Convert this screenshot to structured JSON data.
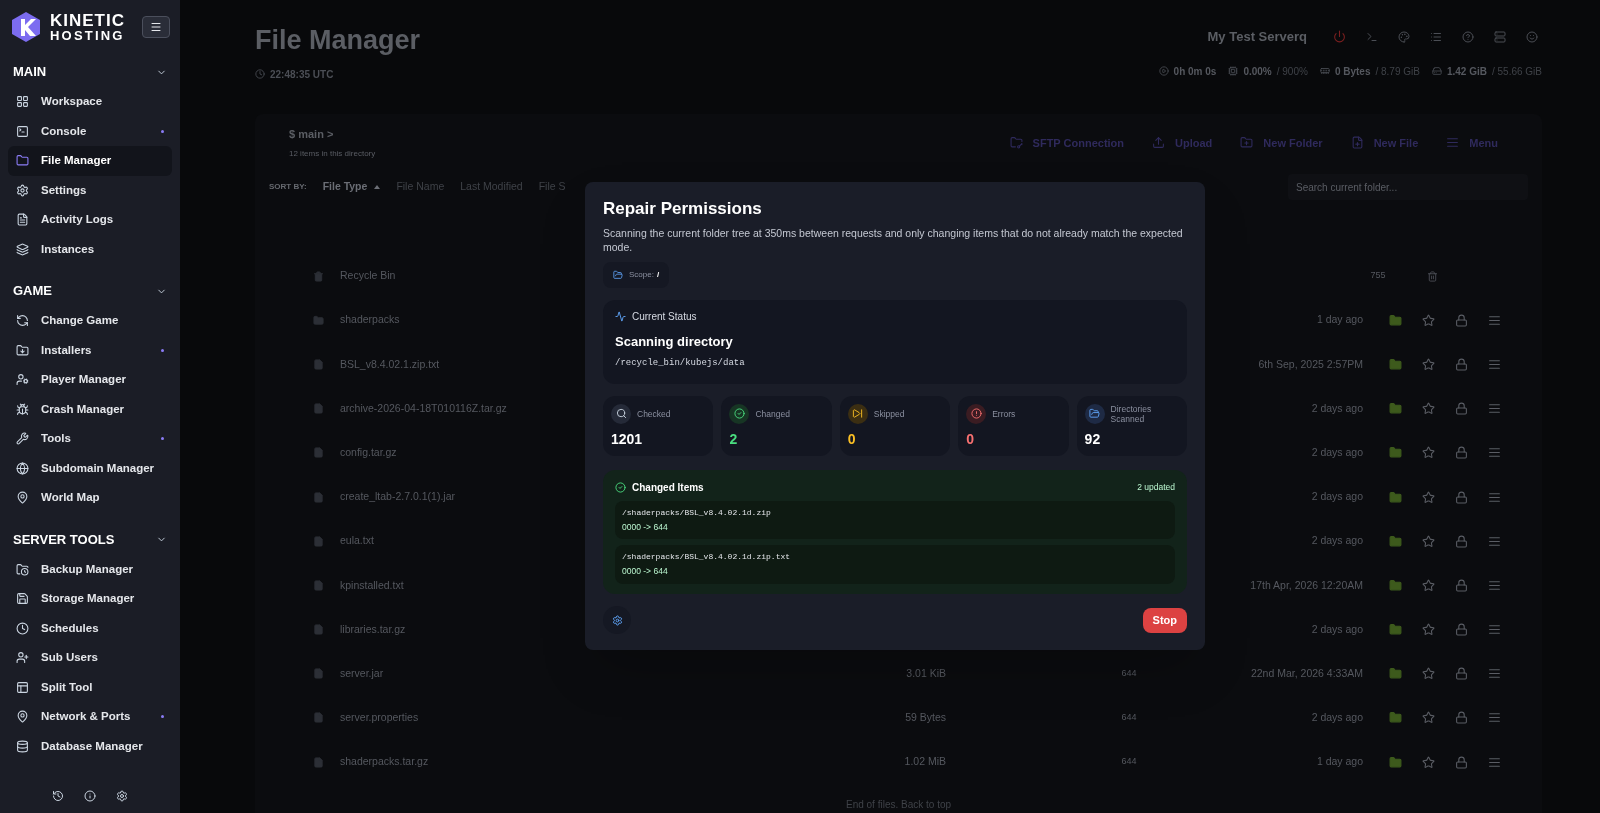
{
  "brand": {
    "line_1": "KINETIC",
    "line_2": "HOSTING"
  },
  "sidebar": {
    "sections": [
      {
        "title": "MAIN",
        "expanded": true,
        "items": [
          {
            "label": "Workspace",
            "selected": false,
            "dot": false
          },
          {
            "label": "Console",
            "selected": false,
            "dot": true
          },
          {
            "label": "File Manager",
            "selected": true,
            "dot": false
          },
          {
            "label": "Settings",
            "selected": false,
            "dot": false
          },
          {
            "label": "Activity Logs",
            "selected": false,
            "dot": false
          },
          {
            "label": "Instances",
            "selected": false,
            "dot": false
          }
        ]
      },
      {
        "title": "GAME",
        "expanded": true,
        "items": [
          {
            "label": "Change Game",
            "selected": false,
            "dot": false
          },
          {
            "label": "Installers",
            "selected": false,
            "dot": true
          },
          {
            "label": "Player Manager",
            "selected": false,
            "dot": false
          },
          {
            "label": "Crash Manager",
            "selected": false,
            "dot": false
          },
          {
            "label": "Tools",
            "selected": false,
            "dot": true
          },
          {
            "label": "Subdomain Manager",
            "selected": false,
            "dot": false
          },
          {
            "label": "World Map",
            "selected": false,
            "dot": false
          }
        ]
      },
      {
        "title": "SERVER TOOLS",
        "expanded": true,
        "items": [
          {
            "label": "Backup Manager",
            "selected": false,
            "dot": false
          },
          {
            "label": "Storage Manager",
            "selected": false,
            "dot": false
          },
          {
            "label": "Schedules",
            "selected": false,
            "dot": false
          },
          {
            "label": "Sub Users",
            "selected": false,
            "dot": false
          },
          {
            "label": "Split Tool",
            "selected": false,
            "dot": false
          },
          {
            "label": "Network & Ports",
            "selected": false,
            "dot": true
          },
          {
            "label": "Database Manager",
            "selected": false,
            "dot": false
          }
        ]
      }
    ]
  },
  "header": {
    "title": "File Manager",
    "clock": "22:48:35 UTC",
    "server_name": "My Test Serverq",
    "stats": [
      {
        "value": "0h 0m 0s"
      },
      {
        "value": "0.00%",
        "limit": "/ 900%"
      },
      {
        "value": "0 Bytes",
        "limit": "/ 8.79 GiB"
      },
      {
        "value": "1.42 GiB",
        "limit": "/ 55.66 GiB"
      }
    ]
  },
  "toolbar": {
    "path": "$ main >",
    "item_count": "12 items in this directory",
    "buttons": [
      "SFTP Connection",
      "Upload",
      "New Folder",
      "New File",
      "Menu"
    ]
  },
  "sort": {
    "label": "SORT BY:",
    "options": [
      {
        "label": "File Type",
        "selected": true
      },
      {
        "label": "File Name",
        "selected": false
      },
      {
        "label": "Last Modified",
        "selected": false
      },
      {
        "label": "File S",
        "selected": false
      }
    ]
  },
  "search": {
    "placeholder": "Search current folder..."
  },
  "files": [
    {
      "kind": "bin",
      "name": "Recycle Bin",
      "mode": "755"
    },
    {
      "kind": "folder",
      "name": "shaderpacks",
      "modified": "1 day ago"
    },
    {
      "kind": "file",
      "name": "BSL_v8.4.02.1.zip.txt",
      "modified": "6th Sep, 2025 2:57PM"
    },
    {
      "kind": "file",
      "name": "archive-2026-04-18T010116Z.tar.gz",
      "modified": "2 days ago"
    },
    {
      "kind": "file",
      "name": "config.tar.gz",
      "modified": "2 days ago"
    },
    {
      "kind": "file",
      "name": "create_ltab-2.7.0.1(1).jar",
      "modified": "2 days ago"
    },
    {
      "kind": "file",
      "name": "eula.txt",
      "modified": "2 days ago"
    },
    {
      "kind": "file",
      "name": "kpinstalled.txt",
      "modified": "17th Apr, 2026 12:20AM"
    },
    {
      "kind": "file",
      "name": "libraries.tar.gz",
      "modified": "2 days ago"
    },
    {
      "kind": "file",
      "name": "server.jar",
      "size": "3.01 KiB",
      "mode": "644",
      "modified": "22nd Mar, 2026 4:33AM"
    },
    {
      "kind": "file",
      "name": "server.properties",
      "size": "59 Bytes",
      "mode": "644",
      "modified": "2 days ago"
    },
    {
      "kind": "file",
      "name": "shaderpacks.tar.gz",
      "size": "1.02 MiB",
      "mode": "644",
      "modified": "1 day ago"
    }
  ],
  "footer": "End of files. Back to top",
  "dialog": {
    "title": "Repair Permissions",
    "description": "Scanning the current folder tree at 350ms between requests and only changing items that do not already match the expected mode.",
    "scope": {
      "label": "Scope:",
      "value": "/"
    },
    "status": {
      "heading": "Current Status",
      "state": "Scanning directory",
      "path": "/recycle_bin/kubejs/data"
    },
    "stats": [
      {
        "kind": "checked",
        "label": "Checked",
        "value": "1201"
      },
      {
        "kind": "changed",
        "label": "Changed",
        "value": "2"
      },
      {
        "kind": "skipped",
        "label": "Skipped",
        "value": "0"
      },
      {
        "kind": "errors",
        "label": "Errors",
        "value": "0"
      },
      {
        "kind": "directories",
        "label": "Directories Scanned",
        "value": "92"
      }
    ],
    "changed": {
      "heading": "Changed Items",
      "count": "2 updated",
      "items": [
        {
          "path": "/shaderpacks/BSL_v8.4.02.1d.zip",
          "change": "0000 -> 644"
        },
        {
          "path": "/shaderpacks/BSL_v8.4.02.1d.zip.txt",
          "change": "0000 -> 644"
        }
      ]
    },
    "stop_button": "Stop"
  }
}
